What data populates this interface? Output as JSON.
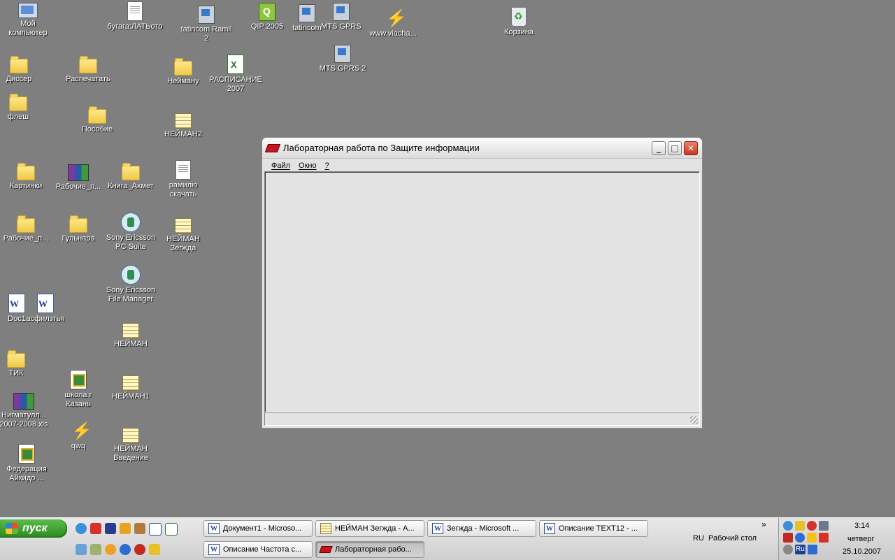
{
  "desktop": {
    "icons": {
      "my_computer": "Мой\nкомпьютер",
      "bugaga": "бугага:ЛАТЬото",
      "tatincom_ramil": "tatincom Ramil\n2",
      "qip": "QIP 2005",
      "tatincom": "tatincom",
      "mts_gprs": "MTS GPRS",
      "viacha": "www.viacha...",
      "recycle": "Корзина",
      "disser": "Диссер",
      "raspechatat": "Распечатать",
      "neymanu": "Нейману",
      "raspisanie": "РАСПИСАНИЕ\n2007",
      "mts_gprs2": "MTS GPRS 2",
      "flesh": "флеш",
      "posobie": "Пособие",
      "neyman2": "НЕЙМАН2",
      "kartinki": "Картинки",
      "rabochie_rar": "Рабочие_п...",
      "kniga": "Книга_Ахмет",
      "ramilyu": "рамилю\nскачать",
      "rabochie_folder": "Рабочие_п...",
      "gulnara": "Гульнара",
      "sony_pc": "Sony Ericsson\nPC Suite",
      "neyman_zegzhda": "НЕЙМАН\nЗегжда",
      "sony_fm": "Sony Ericsson\nFile Manager",
      "doc1": "Doc1",
      "asfilzt": "асфилзтья",
      "neyman": "НЕЙМАН",
      "tik": "ТИК",
      "shkola": "школа г\nКазань",
      "neyman1": "НЕЙМАН1",
      "nigmatull": "Нигматулл...\n2007-2008.xls",
      "qwq": "qwq",
      "neyman_vvedenie": "НЕЙМАН\nВведение",
      "federaciya": "Федерация\nАйкидо ..."
    }
  },
  "window": {
    "title": "Лабораторная работа по Защите информации",
    "menu": [
      "Файл",
      "Окно",
      "?"
    ]
  },
  "taskbar": {
    "start_label": "пуск",
    "tasks": [
      "Документ1 - Microso...",
      "НЕЙМАН Зегжда - A...",
      "Зегжда - Microsoft ...",
      "Описание TEXT12 - ...",
      "Описание Частота с...",
      "Лабораторная рабо..."
    ],
    "chevron": "»",
    "lang": "RU",
    "desktop_toolbar": "Рабочий стол",
    "tray_lang": "Ru",
    "time": "3:14",
    "weekday": "четверг",
    "date": "25.10.2007"
  }
}
